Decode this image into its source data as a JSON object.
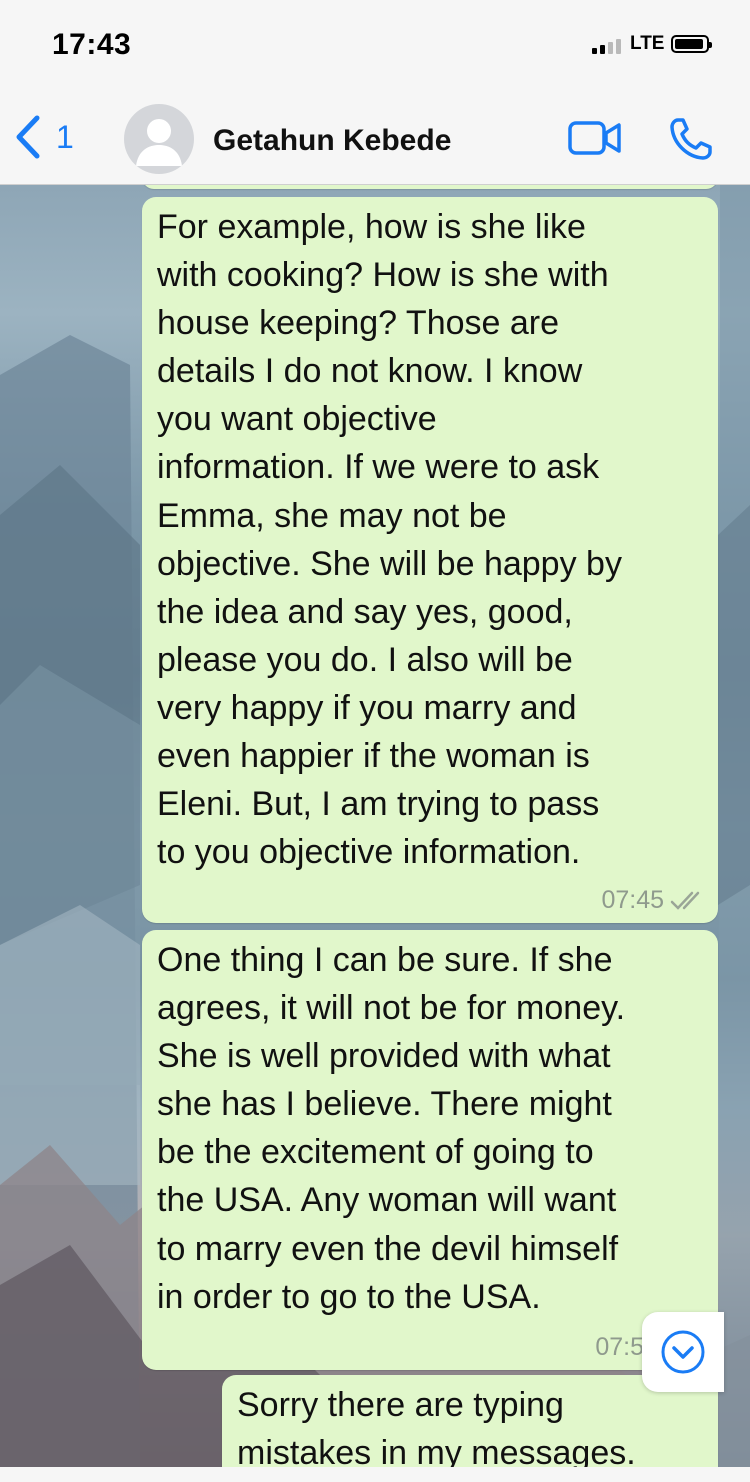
{
  "status_bar": {
    "time": "17:43",
    "network": "LTE"
  },
  "header": {
    "back_count": "1",
    "contact_name": "Getahun Kebede",
    "icons": {
      "back": "chevron-left-icon",
      "avatar": "person-icon",
      "video": "video-camera-icon",
      "call": "phone-icon"
    }
  },
  "messages": [
    {
      "text": "For example, how is she like\nwith cooking? How is she with\nhouse keeping? Those are\ndetails I do not know. I know\nyou want objective\ninformation. If we were to ask\nEmma, she may not be\nobjective. She will be happy by\nthe idea and say yes, good,\nplease you do. I also will be\nvery happy if you marry and\neven happier if the woman is\nEleni. But, I am trying to pass\nto you objective information.",
      "time": "07:45",
      "status": "read"
    },
    {
      "text": "One thing I can be sure. If she\nagrees, it will not be for money.\nShe is well provided with what\nshe has I believe. There might\nbe the excitement of going to\nthe USA. Any woman will want\nto marry even the devil himself\nin order to go to the USA.",
      "time": "07:5"
    },
    {
      "text": "Sorry there are typing\nmistakes in my messages."
    }
  ],
  "colors": {
    "accent": "#1a7cf5",
    "outgoing_bubble": "#e1f7cb",
    "header_bg": "#f6f6f6"
  },
  "scroll_button_icon": "chevron-down-circle-icon"
}
